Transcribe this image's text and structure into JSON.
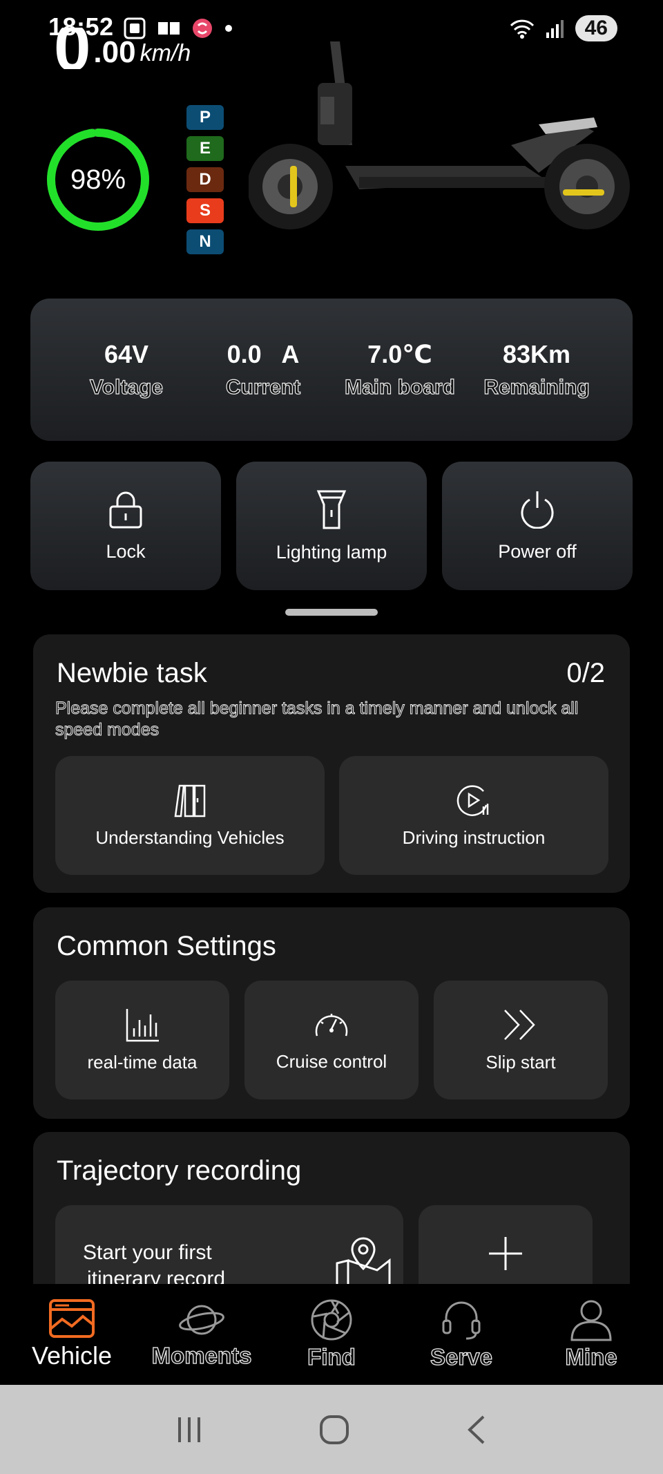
{
  "status_bar": {
    "time": "18:52",
    "battery": "46"
  },
  "speed": {
    "integer": "0",
    "decimal": ".00",
    "unit": "km/h"
  },
  "battery_percent": "98%",
  "battery_level": 0.98,
  "gears": [
    {
      "letter": "P",
      "color": "#0c4d74"
    },
    {
      "letter": "E",
      "color": "#1f6a1c"
    },
    {
      "letter": "D",
      "color": "#6b2a10"
    },
    {
      "letter": "S",
      "color": "#e93c1c"
    },
    {
      "letter": "N",
      "color": "#0c4d74"
    }
  ],
  "stats": [
    {
      "value": "64V",
      "label": "Voltage"
    },
    {
      "value": "0.0   A",
      "label": "Current"
    },
    {
      "value": "7.0℃",
      "label": "Main board"
    },
    {
      "value": "83Km",
      "label": "Remaining"
    }
  ],
  "controls": [
    {
      "label": "Lock",
      "icon": "lock-icon"
    },
    {
      "label": "Lighting lamp",
      "icon": "flashlight-icon"
    },
    {
      "label": "Power off",
      "icon": "power-icon"
    }
  ],
  "newbie": {
    "title": "Newbie task",
    "progress": "0/2",
    "note": "Please complete all beginner tasks in a timely manner and unlock all speed modes",
    "tasks": [
      {
        "label": "Understanding Vehicles",
        "icon": "book-icon"
      },
      {
        "label": "Driving instruction",
        "icon": "play-circle-icon"
      }
    ]
  },
  "settings": {
    "title": "Common Settings",
    "items": [
      {
        "label": "real-time data",
        "icon": "bar-chart-icon"
      },
      {
        "label": "Cruise control",
        "icon": "speedometer-icon"
      },
      {
        "label": "Slip start",
        "icon": "double-chevron-icon"
      }
    ]
  },
  "trajectory": {
    "title": "Trajectory recording",
    "start_line1": "Start your first",
    "start_line2": "itinerary record"
  },
  "nav": [
    {
      "label": "Vehicle",
      "icon": "vehicle-icon",
      "active": true
    },
    {
      "label": "Moments",
      "icon": "planet-icon"
    },
    {
      "label": "Find",
      "icon": "aperture-icon"
    },
    {
      "label": "Serve",
      "icon": "headset-icon"
    },
    {
      "label": "Mine",
      "icon": "person-icon"
    }
  ],
  "colors": {
    "accent": "#f26b21",
    "ring": "#22e02a"
  }
}
